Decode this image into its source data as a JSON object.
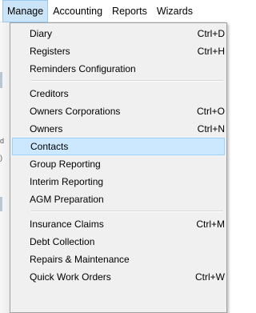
{
  "menubar": {
    "items": [
      "Manage",
      "Accounting",
      "Reports",
      "Wizards"
    ],
    "active_index": 0
  },
  "underlying": {
    "fragments": [
      "d",
      ")"
    ]
  },
  "menu": {
    "groups": [
      [
        {
          "label": "Diary",
          "shortcut": "Ctrl+D"
        },
        {
          "label": "Registers",
          "shortcut": "Ctrl+H"
        },
        {
          "label": "Reminders Configuration",
          "shortcut": ""
        }
      ],
      [
        {
          "label": "Creditors",
          "shortcut": ""
        },
        {
          "label": "Owners Corporations",
          "shortcut": "Ctrl+O"
        },
        {
          "label": "Owners",
          "shortcut": "Ctrl+N"
        },
        {
          "label": "Contacts",
          "shortcut": "",
          "highlighted": true
        },
        {
          "label": "Group Reporting",
          "shortcut": ""
        },
        {
          "label": "Interim Reporting",
          "shortcut": ""
        },
        {
          "label": "AGM Preparation",
          "shortcut": ""
        }
      ],
      [
        {
          "label": "Insurance Claims",
          "shortcut": "Ctrl+M"
        },
        {
          "label": "Debt Collection",
          "shortcut": ""
        },
        {
          "label": "Repairs & Maintenance",
          "shortcut": ""
        },
        {
          "label": "Quick Work Orders",
          "shortcut": "Ctrl+W"
        }
      ]
    ]
  },
  "colors": {
    "menu_background": "#f0f0f0",
    "highlight": "#cce8ff",
    "highlight_border": "#99d1ff",
    "menubar_active": "#cce4f7"
  }
}
